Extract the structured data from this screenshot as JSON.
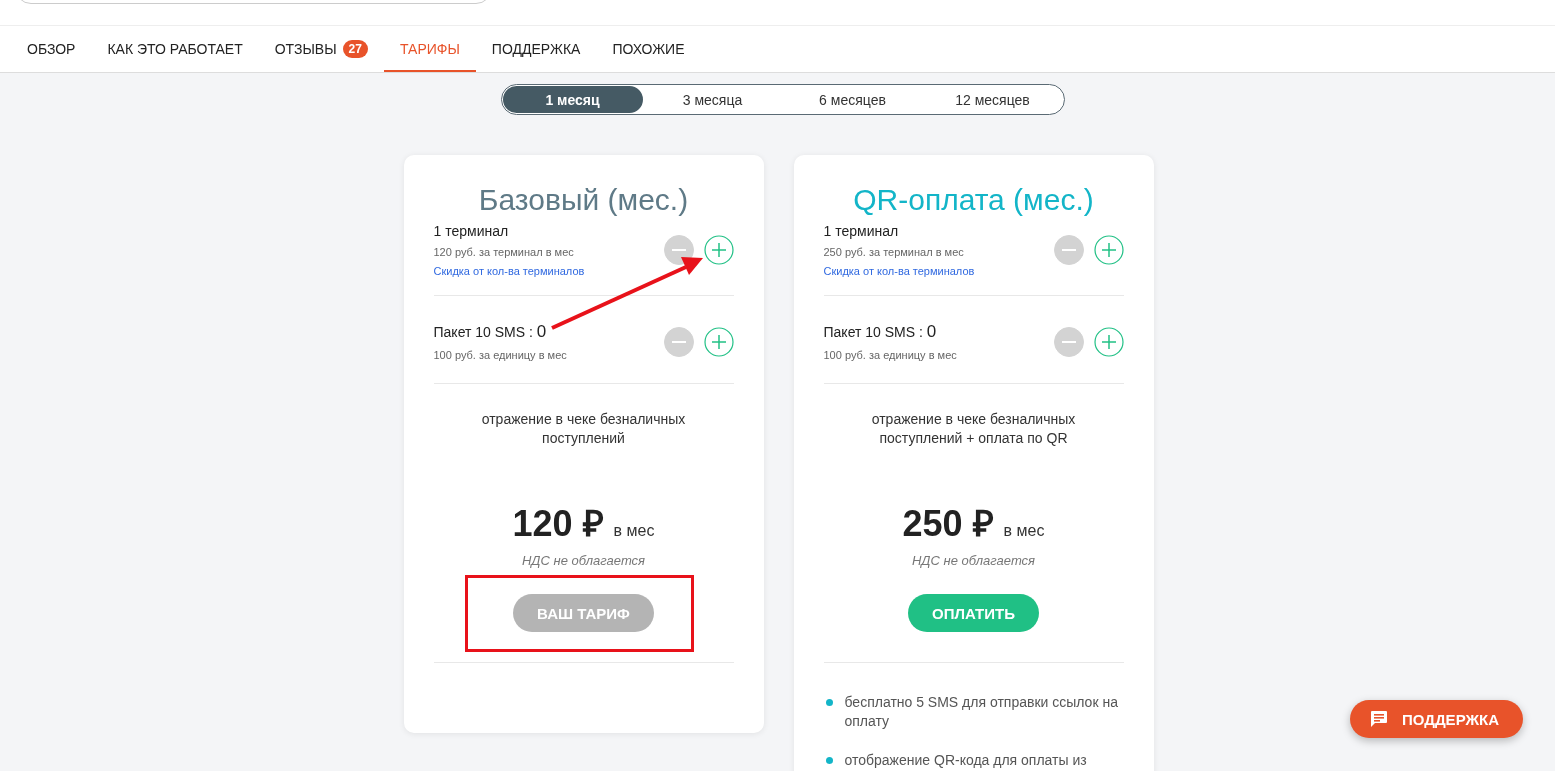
{
  "nav": {
    "tabs": [
      {
        "label": "ОБЗОР",
        "selected": false
      },
      {
        "label": "КАК ЭТО РАБОТАЕТ",
        "selected": false
      },
      {
        "label": "ОТЗЫВЫ",
        "badge": "27",
        "selected": false
      },
      {
        "label": "ТАРИФЫ",
        "selected": true
      },
      {
        "label": "ПОДДЕРЖКА",
        "selected": false
      },
      {
        "label": "ПОХОЖИЕ",
        "selected": false
      }
    ]
  },
  "periods": [
    {
      "label": "1 месяц",
      "selected": true
    },
    {
      "label": "3 месяца",
      "selected": false
    },
    {
      "label": "6 месяцев",
      "selected": false
    },
    {
      "label": "12 месяцев",
      "selected": false
    }
  ],
  "plans": [
    {
      "title": "Базовый (мес.)",
      "color": "#5f7a87",
      "terminal": {
        "name": "1 терминал",
        "price": "120 руб. за терминал в мес",
        "link": "Скидка от кол-ва терминалов",
        "decrement_disabled": true
      },
      "sms": {
        "label": "Пакет 10 SMS :",
        "count": "0",
        "price": "100 руб. за единицу в мес",
        "decrement_disabled": true
      },
      "description": "отражение в чеке безналичных поступлений",
      "price": "120 ₽",
      "period": "в мес",
      "vat": "НДС не облагается",
      "button": {
        "label": "ВАШ ТАРИФ",
        "disabled": true
      }
    },
    {
      "title": "QR-оплата (мес.)",
      "color": "#13b5c8",
      "terminal": {
        "name": "1 терминал",
        "price": "250 руб. за терминал в мес",
        "link": "Скидка от кол-ва терминалов",
        "decrement_disabled": true
      },
      "sms": {
        "label": "Пакет 10 SMS :",
        "count": "0",
        "price": "100 руб. за единицу в мес",
        "decrement_disabled": true
      },
      "description": "отражение в чеке безналичных поступлений + оплата по QR",
      "price": "250 ₽",
      "period": "в мес",
      "vat": "НДС не облагается",
      "button": {
        "label": "ОПЛАТИТЬ",
        "disabled": false
      },
      "features": [
        "бесплатно 5 SMS для отправки ссылок на оплату",
        "отображение QR-кода для оплаты из"
      ]
    }
  ],
  "support_button": {
    "label": "ПОДДЕРЖКА"
  }
}
